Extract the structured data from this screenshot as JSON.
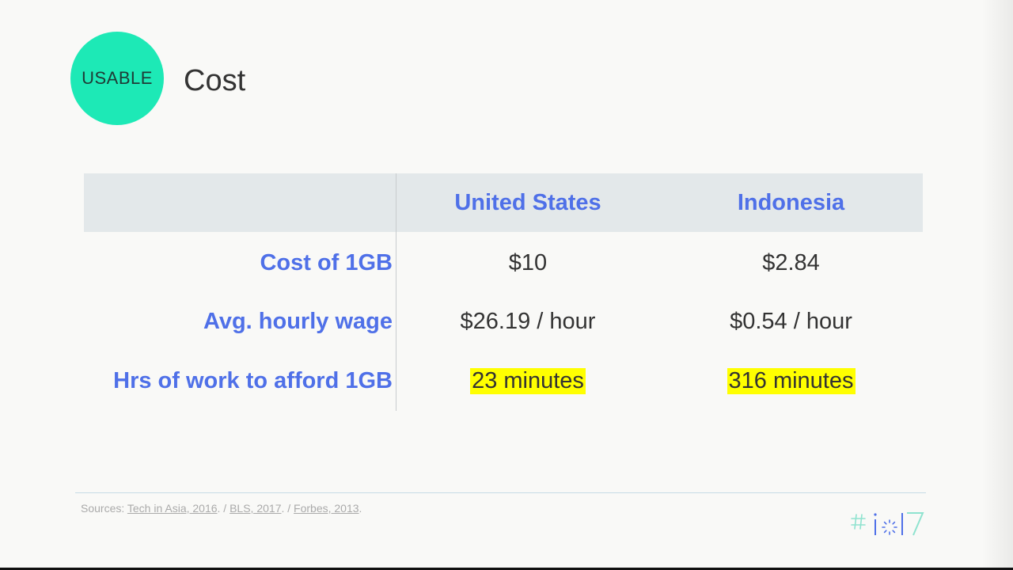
{
  "badge": {
    "label": "USABLE"
  },
  "title": "Cost",
  "table": {
    "columns": [
      "United States",
      "Indonesia"
    ],
    "rows": [
      {
        "label": "Cost of 1GB",
        "us": "$10",
        "id": "$2.84",
        "highlight": false
      },
      {
        "label": "Avg. hourly wage",
        "us": "$26.19 / hour",
        "id": "$0.54 / hour",
        "highlight": false
      },
      {
        "label": "Hrs of work to afford 1GB",
        "us": "23 minutes",
        "id": "316 minutes",
        "highlight": true
      }
    ]
  },
  "sources": {
    "prefix": "Sources: ",
    "links": [
      "Tech in Asia, 2016",
      "BLS, 2017",
      "Forbes, 2013"
    ],
    "sep1": ". / ",
    "sep2": ". / ",
    "end": "."
  },
  "logo": {
    "name": "io17-logo",
    "icon": "hash-io-17-icon"
  },
  "colors": {
    "badge": "#1de9b6",
    "accent": "#4f70e8",
    "highlight": "#ffff00",
    "header_band": "#e3e8ea"
  }
}
